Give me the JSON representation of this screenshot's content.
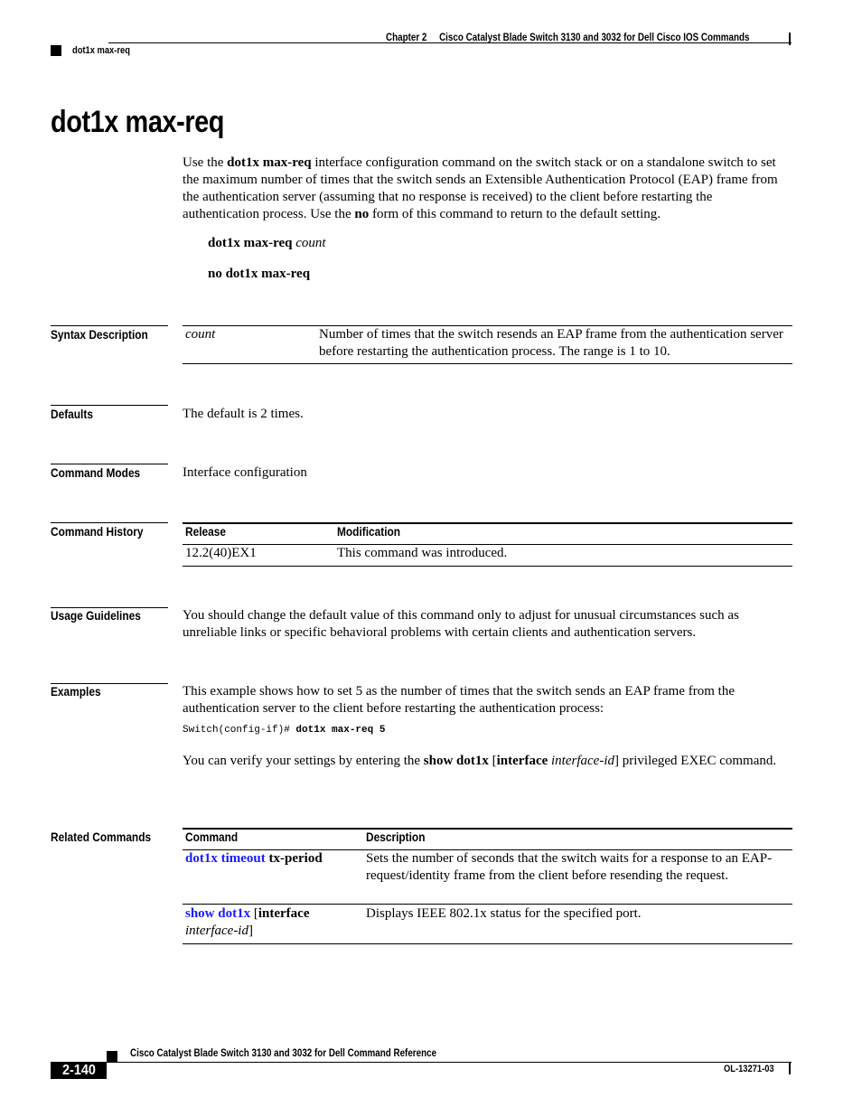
{
  "header": {
    "chapter": "Chapter 2",
    "book_section": "Cisco Catalyst Blade Switch 3130 and 3032 for Dell Cisco IOS Commands",
    "command": "dot1x max-req"
  },
  "title": "dot1x max-req",
  "intro": {
    "p1": "Use the ",
    "b1": "dot1x max-req",
    "p2": " interface configuration command on the switch stack or on a standalone switch to set the maximum number of times that the switch sends an Extensible Authentication Protocol (EAP) frame from the authentication server (assuming that no response is received) to the client before restarting the authentication process. Use the ",
    "b2": "no",
    "p3": " form of this command to return to the default setting."
  },
  "syntax": {
    "line1_cmd": "dot1x max-req",
    "line1_arg": "count",
    "line2_cmd": "no dot1x max-req"
  },
  "sections": {
    "syntax_description": {
      "label": "Syntax Description",
      "rows": [
        {
          "param": "count",
          "desc": "Number of times that the switch resends an EAP frame from the authentication server before restarting the authentication process. The range is 1 to 10."
        }
      ]
    },
    "defaults": {
      "label": "Defaults",
      "text": "The default is 2 times."
    },
    "command_modes": {
      "label": "Command Modes",
      "text": "Interface configuration"
    },
    "command_history": {
      "label": "Command History",
      "headers": [
        "Release",
        "Modification"
      ],
      "rows": [
        {
          "release": "12.2(40)EX1",
          "modification": "This command was introduced."
        }
      ]
    },
    "usage_guidelines": {
      "label": "Usage Guidelines",
      "text": "You should change the default value of this command only to adjust for unusual circumstances such as unreliable links or specific behavioral problems with certain clients and authentication servers."
    },
    "examples": {
      "label": "Examples",
      "text": "This example shows how to set 5 as the number of times that the switch sends an EAP frame from the authentication server to the client before restarting the authentication process:",
      "code_prompt": "Switch(config-if)# ",
      "code_cmd": "dot1x max-req 5",
      "verify_p1": "You can verify your settings by entering the ",
      "verify_b1": "show dot1x",
      "verify_p2": " [",
      "verify_b2": "interface",
      "verify_p3": " ",
      "verify_i1": "interface-id",
      "verify_p4": "] privileged EXEC command."
    },
    "related_commands": {
      "label": "Related Commands",
      "headers": [
        "Command",
        "Description"
      ],
      "rows": [
        {
          "link": "dot1x timeout",
          "rest_bold": " tx-period",
          "desc": "Sets the number of seconds that the switch waits for a response to an EAP-request/identity frame from the client before resending the request."
        },
        {
          "link": "show dot1x",
          "rest_plain": " [",
          "rest_bold": "interface",
          "rest_italic": "interface-id",
          "rest_close": "]",
          "desc": "Displays IEEE 802.1x status for the specified port."
        }
      ]
    }
  },
  "footer": {
    "book_title": "Cisco Catalyst Blade Switch 3130 and 3032 for Dell Command Reference",
    "page": "2-140",
    "doc_number": "OL-13271-03"
  },
  "colors": {
    "link": "#1a1aff",
    "text": "#000000"
  }
}
